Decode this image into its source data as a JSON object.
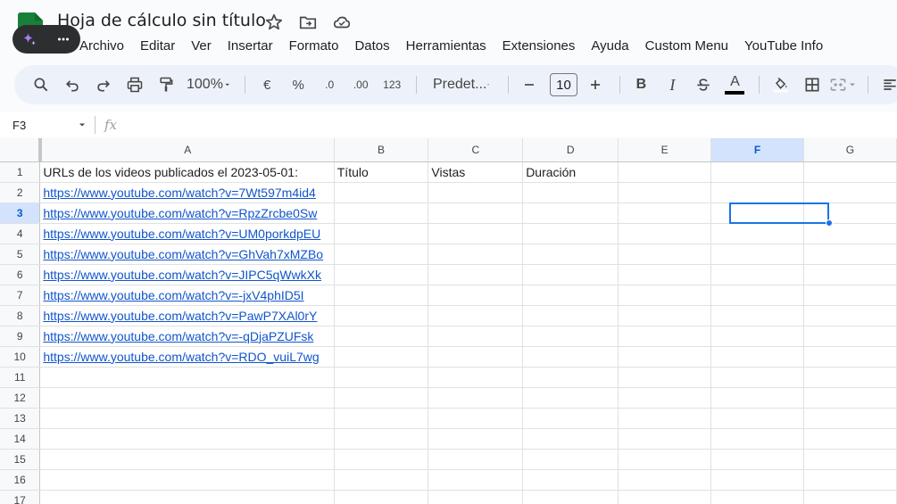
{
  "doc": {
    "title": "Hoja de cálculo sin título"
  },
  "menu": [
    "Archivo",
    "Editar",
    "Ver",
    "Insertar",
    "Formato",
    "Datos",
    "Herramientas",
    "Extensiones",
    "Ayuda",
    "Custom Menu",
    "YouTube Info"
  ],
  "toolbar": {
    "zoom": "100%",
    "currency": "€",
    "percent": "%",
    "decrease_decimals": ".0",
    "increase_decimals": ".00",
    "number_format": "123",
    "font": "Predet...",
    "font_size": "10",
    "bold": "B",
    "italic": "I",
    "text_color_label": "A"
  },
  "formula_bar": {
    "cell_ref": "F3",
    "fx": "fx",
    "value": ""
  },
  "columns": [
    "A",
    "B",
    "C",
    "D",
    "E",
    "F",
    "G"
  ],
  "selected": {
    "column": "F",
    "row": 3
  },
  "rows": [
    {
      "n": "1",
      "a": "URLs de los videos publicados el 2023-05-01:",
      "b": "Título",
      "c": "Vistas",
      "d": "Duración",
      "link": false
    },
    {
      "n": "2",
      "a": "https://www.youtube.com/watch?v=7Wt597m4id4",
      "link": true
    },
    {
      "n": "3",
      "a": "https://www.youtube.com/watch?v=RpzZrcbe0Sw",
      "link": true
    },
    {
      "n": "4",
      "a": "https://www.youtube.com/watch?v=UM0porkdpEU",
      "link": true
    },
    {
      "n": "5",
      "a": "https://www.youtube.com/watch?v=GhVah7xMZBo",
      "link": true
    },
    {
      "n": "6",
      "a": "https://www.youtube.com/watch?v=JIPC5qWwkXk",
      "link": true
    },
    {
      "n": "7",
      "a": "https://www.youtube.com/watch?v=-jxV4phID5I",
      "link": true
    },
    {
      "n": "8",
      "a": "https://www.youtube.com/watch?v=PawP7XAl0rY",
      "link": true
    },
    {
      "n": "9",
      "a": "https://www.youtube.com/watch?v=-qDjaPZUFsk",
      "link": true
    },
    {
      "n": "10",
      "a": "https://www.youtube.com/watch?v=RDO_vuiL7wg",
      "link": true
    },
    {
      "n": "11",
      "a": ""
    },
    {
      "n": "12",
      "a": ""
    },
    {
      "n": "13",
      "a": ""
    },
    {
      "n": "14",
      "a": ""
    },
    {
      "n": "15",
      "a": ""
    },
    {
      "n": "16",
      "a": ""
    },
    {
      "n": "17",
      "a": ""
    }
  ],
  "colors": {
    "accent": "#1a73e8",
    "link": "#1155cc",
    "logo": "#188038"
  }
}
